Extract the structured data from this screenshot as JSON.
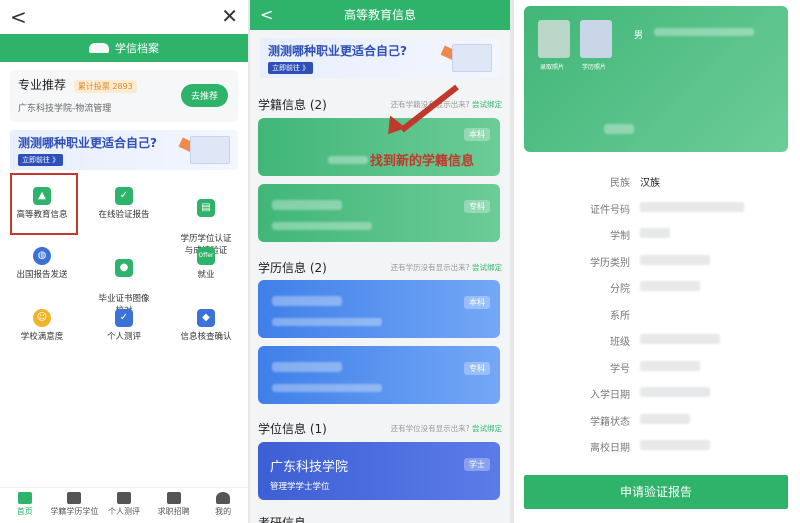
{
  "panel1": {
    "back_glyph": "<",
    "close_glyph": "✕",
    "brand": "学信档案",
    "recommend": {
      "title": "专业推荐",
      "badge": "累计投票 2893",
      "school": "广东科技学院-物流管理",
      "button": "去推荐"
    },
    "banner": {
      "title": "测测哪种职业更适合自己?",
      "button": "立即前往 》"
    },
    "grid": [
      {
        "label": "高等教育信息",
        "icon": "graduate-icon",
        "color": "#2fb36b"
      },
      {
        "label": "在线验证报告",
        "icon": "shield-check-icon",
        "color": "#2fb36b"
      },
      {
        "label": "学历学位认证\n与成绩验证",
        "icon": "certificate-icon",
        "color": "#2fb36b"
      },
      {
        "label": "出国报告发送",
        "icon": "globe-icon",
        "color": "#3a72d8"
      },
      {
        "label": "毕业证书图像\n校对",
        "icon": "user-check-icon",
        "color": "#2fb36b"
      },
      {
        "label": "就业",
        "icon": "offer-icon",
        "color": "#2fb36b"
      },
      {
        "label": "学校满意度",
        "icon": "smile-icon",
        "color": "#f0b429"
      },
      {
        "label": "个人测评",
        "icon": "clipboard-check-icon",
        "color": "#3a72d8"
      },
      {
        "label": "信息核查确认",
        "icon": "person-shield-icon",
        "color": "#3a72d8"
      }
    ],
    "tabs": [
      {
        "label": "首页",
        "icon": "home-icon",
        "active": true
      },
      {
        "label": "学籍学历学位",
        "icon": "cap-icon",
        "active": false
      },
      {
        "label": "个人测评",
        "icon": "clipboard-icon",
        "active": false
      },
      {
        "label": "求职招聘",
        "icon": "briefcase-icon",
        "active": false
      },
      {
        "label": "我的",
        "icon": "person-icon",
        "active": false
      }
    ]
  },
  "panel2": {
    "title": "高等教育信息",
    "back_glyph": "<",
    "banner": {
      "title": "测测哪种职业更适合自己?",
      "button": "立即前往 》"
    },
    "xueji": {
      "heading": "学籍信息 (2)",
      "hint": "还有学籍没有显示出来?",
      "hint_link": "尝试绑定",
      "cards": [
        {
          "tag": "本科"
        },
        {
          "tag": "专科"
        }
      ]
    },
    "xueli": {
      "heading": "学历信息 (2)",
      "hint": "还有学历没有显示出来?",
      "hint_link": "尝试绑定",
      "cards": [
        {
          "tag": "本科"
        },
        {
          "tag": "专科"
        }
      ]
    },
    "xuewei": {
      "heading": "学位信息 (1)",
      "hint": "还有学位没有显示出来?",
      "hint_link": "尝试绑定",
      "card": {
        "school": "广东科技学院",
        "degree": "管理学学士学位",
        "tag": "学士"
      }
    },
    "next_heading": "考研信息",
    "annotation": "找到新的学籍信息"
  },
  "panel3": {
    "photo1_label": "录取照片",
    "photo2_label": "学历照片",
    "gender": "男",
    "fields": [
      {
        "label": "民族",
        "value": "汉族"
      },
      {
        "label": "证件号码",
        "value": ""
      },
      {
        "label": "学制",
        "value": ""
      },
      {
        "label": "学历类别",
        "value": ""
      },
      {
        "label": "分院",
        "value": ""
      },
      {
        "label": "系所",
        "value": ""
      },
      {
        "label": "班级",
        "value": ""
      },
      {
        "label": "学号",
        "value": ""
      },
      {
        "label": "入学日期",
        "value": ""
      },
      {
        "label": "学籍状态",
        "value": ""
      },
      {
        "label": "离校日期",
        "value": ""
      }
    ],
    "button": "申请验证报告"
  }
}
